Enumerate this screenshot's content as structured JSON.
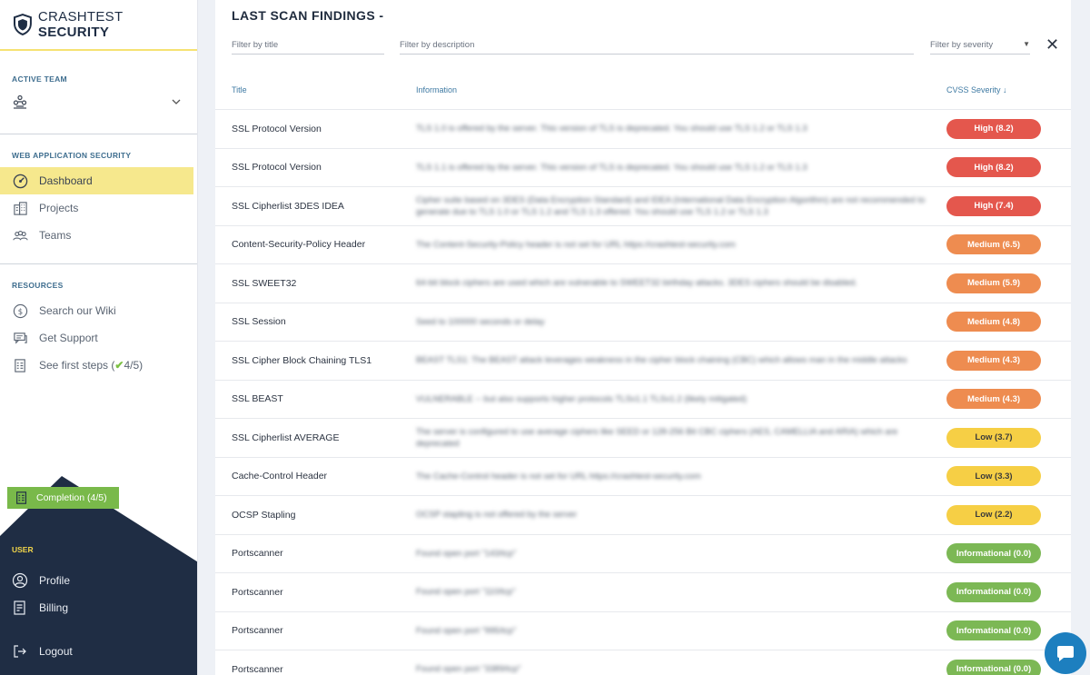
{
  "brand": {
    "name_light": "CRASHTEST ",
    "name_bold": "SECURITY"
  },
  "sidebar": {
    "active_team_label": "ACTIVE TEAM",
    "web_label": "WEB APPLICATION SECURITY",
    "web_items": [
      {
        "label": "Dashboard",
        "icon": "dashboard-icon"
      },
      {
        "label": "Projects",
        "icon": "building-icon"
      },
      {
        "label": "Teams",
        "icon": "people-icon"
      }
    ],
    "resources_label": "RESOURCES",
    "resource_items": [
      {
        "label": "Search our Wiki",
        "icon": "wiki-icon"
      },
      {
        "label": "Get Support",
        "icon": "chat-icon"
      },
      {
        "label_pre": "See first steps (",
        "check": "✔",
        "label_post": "4/5)",
        "icon": "checklist-icon"
      }
    ],
    "completion": "Completion (4/5)",
    "user_label": "USER",
    "user_items": [
      {
        "label": "Profile",
        "icon": "profile-icon"
      },
      {
        "label": "Billing",
        "icon": "billing-icon"
      },
      {
        "label": "Logout",
        "icon": "logout-icon"
      }
    ]
  },
  "panel": {
    "title": "LAST SCAN FINDINGS -",
    "filters": {
      "title_placeholder": "Filter by title",
      "description_placeholder": "Filter by description",
      "severity_placeholder": "Filter by severity"
    },
    "columns": {
      "title": "Title",
      "information": "Information",
      "severity": "CVSS Severity ↓"
    },
    "rows": [
      {
        "title": "SSL Protocol Version",
        "info": "TLS 1.0 is offered by the server. This version of TLS is deprecated. You should use TLS 1.2 or TLS 1.3",
        "severity": "High (8.2)",
        "level": "high"
      },
      {
        "title": "SSL Protocol Version",
        "info": "TLS 1.1 is offered by the server. This version of TLS is deprecated. You should use TLS 1.2 or TLS 1.3",
        "severity": "High (8.2)",
        "level": "high"
      },
      {
        "title": "SSL Cipherlist 3DES IDEA",
        "info": "Cipher suite based on 3DES (Data Encryption Standard) and IDEA (International Data Encryption Algorithm) are not recommended to generate due to TLS 1.0 or TLS 1.2 and TLS 1.3 offered. You should use TLS 1.2 or TLS 1.3",
        "severity": "High (7.4)",
        "level": "high"
      },
      {
        "title": "Content-Security-Policy Header",
        "info": "The Content-Security-Policy header is not set for URL https://crashtest-security.com",
        "severity": "Medium (6.5)",
        "level": "medium"
      },
      {
        "title": "SSL SWEET32",
        "info": "64-bit block ciphers are used which are vulnerable to SWEET32 birthday attacks. 3DES ciphers should be disabled.",
        "severity": "Medium (5.9)",
        "level": "medium"
      },
      {
        "title": "SSL Session",
        "info": "Seed to 100000 seconds or delay",
        "severity": "Medium (4.8)",
        "level": "medium"
      },
      {
        "title": "SSL Cipher Block Chaining TLS1",
        "info": "BEAST TLS1: The BEAST attack leverages weakness in the cipher block chaining (CBC) which allows man in the middle attacks",
        "severity": "Medium (4.3)",
        "level": "medium"
      },
      {
        "title": "SSL BEAST",
        "info": "VULNERABLE -- but also supports higher protocols TLSv1.1 TLSv1.2 (likely mitigated)",
        "severity": "Medium (4.3)",
        "level": "medium"
      },
      {
        "title": "SSL Cipherlist AVERAGE",
        "info": "The server is configured to use average ciphers like SEED or 128-256 Bit CBC ciphers (AES, CAMELLIA and ARIA) which are deprecated",
        "severity": "Low (3.7)",
        "level": "low"
      },
      {
        "title": "Cache-Control Header",
        "info": "The Cache-Control header is not set for URL https://crashtest-security.com",
        "severity": "Low (3.3)",
        "level": "low"
      },
      {
        "title": "OCSP Stapling",
        "info": "OCSP stapling is not offered by the server",
        "severity": "Low (2.2)",
        "level": "low"
      },
      {
        "title": "Portscanner",
        "info": "Found open port \"143/tcp\"",
        "severity": "Informational (0.0)",
        "level": "info"
      },
      {
        "title": "Portscanner",
        "info": "Found open port \"110/tcp\"",
        "severity": "Informational (0.0)",
        "level": "info"
      },
      {
        "title": "Portscanner",
        "info": "Found open port \"995/tcp\"",
        "severity": "Informational (0.0)",
        "level": "info"
      },
      {
        "title": "Portscanner",
        "info": "Found open port \"3389/tcp\"",
        "severity": "Informational (0.0)",
        "level": "info"
      }
    ]
  },
  "colors": {
    "high": "#e4574d",
    "medium": "#ee8c50",
    "low": "#f6cf45",
    "info": "#7cb855",
    "sidebar_dark": "#1f2d44",
    "accent_yellow": "#f6e88d"
  }
}
